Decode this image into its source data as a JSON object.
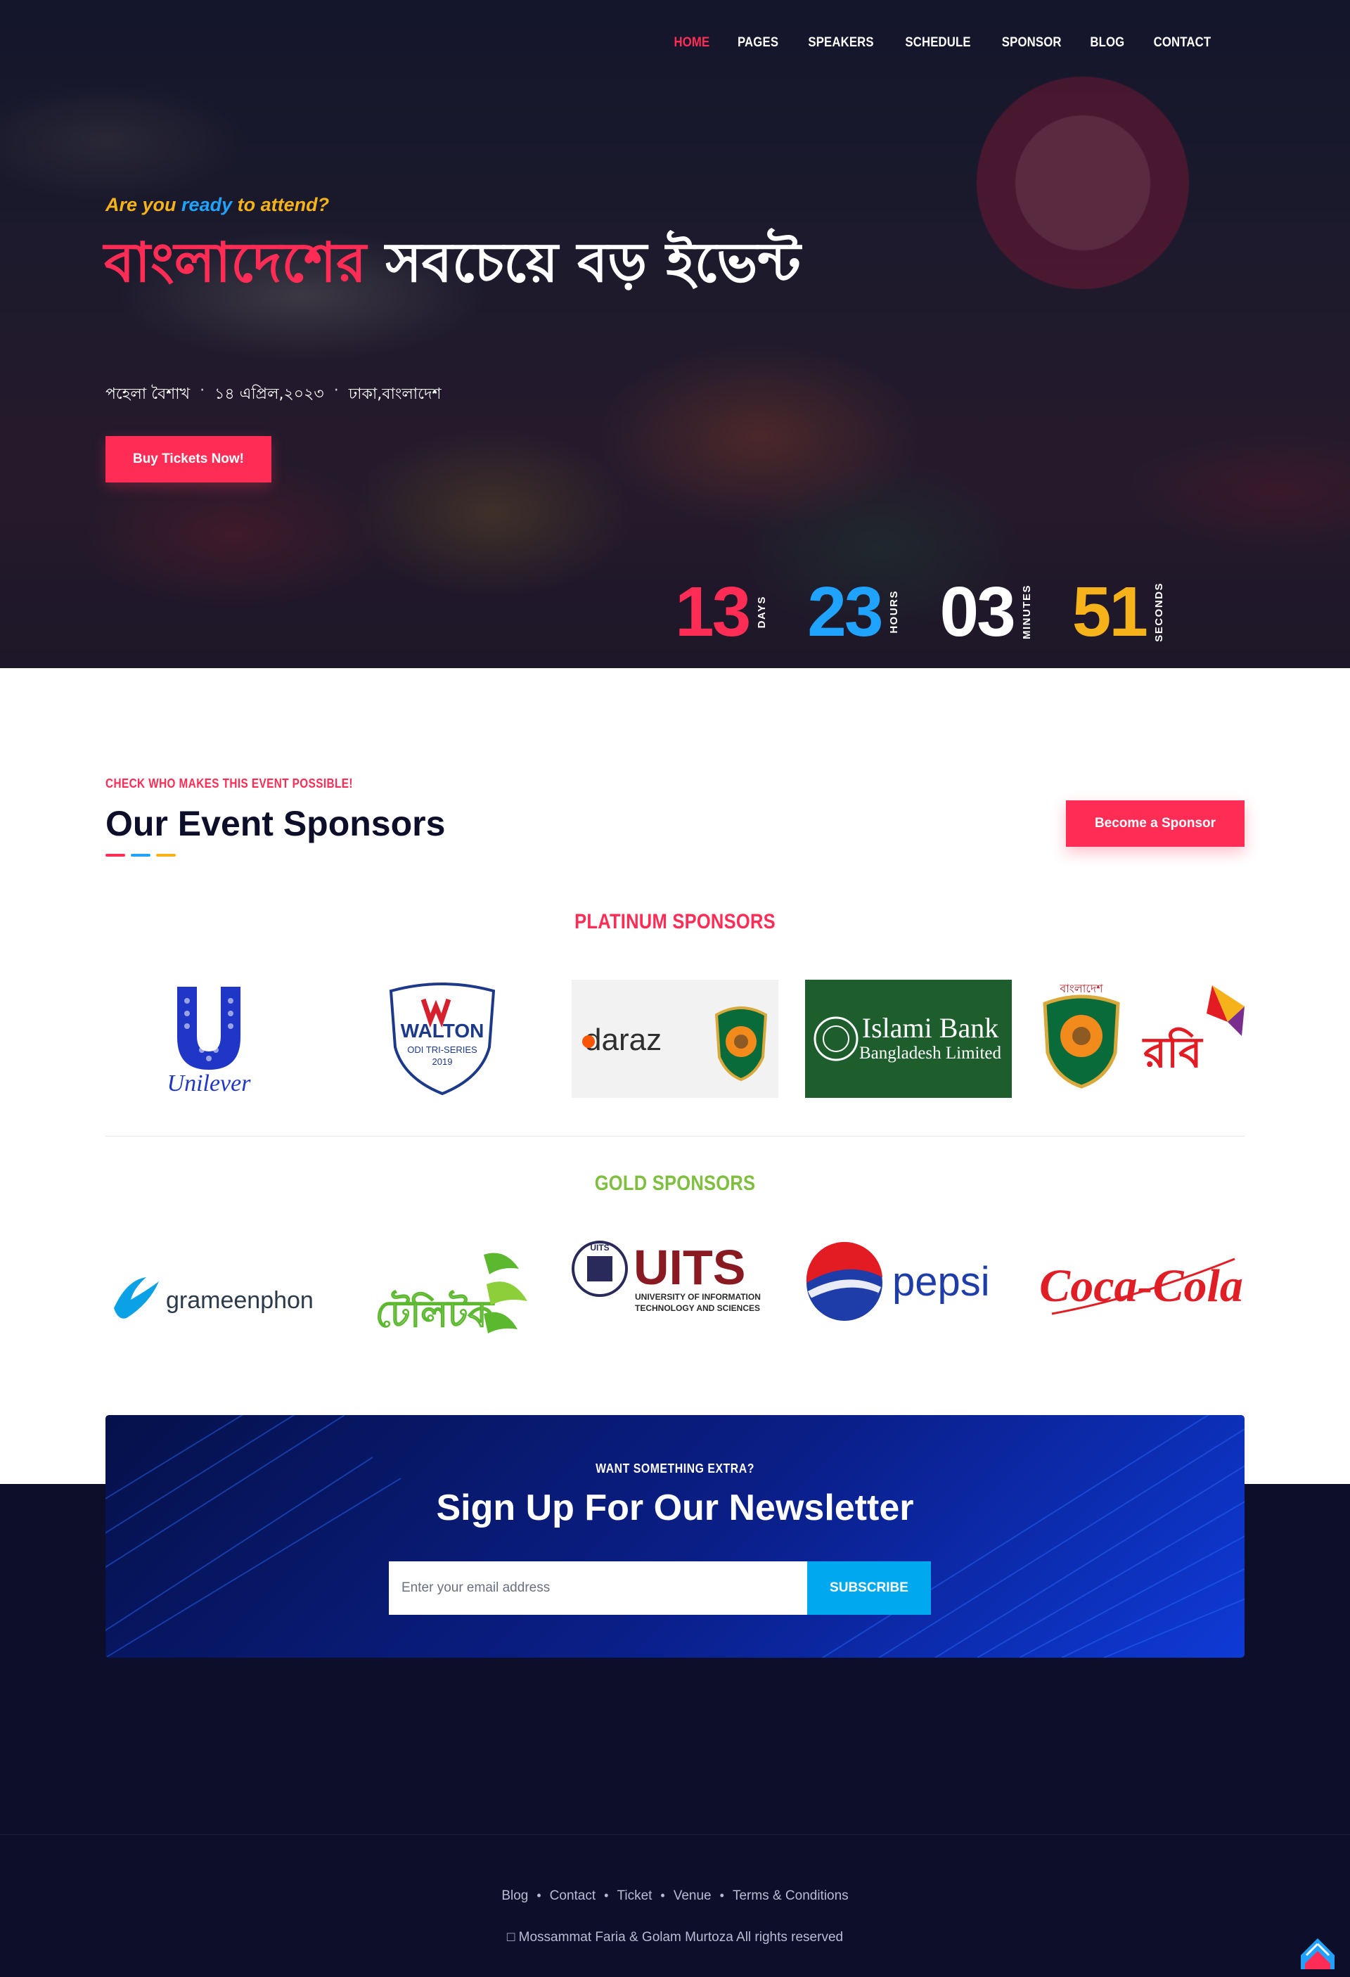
{
  "nav": {
    "items": [
      {
        "label": "HOME",
        "active": true
      },
      {
        "label": "PAGES"
      },
      {
        "label": "SPEAKERS"
      },
      {
        "label": "SCHEDULE"
      },
      {
        "label": "SPONSOR"
      },
      {
        "label": "BLOG"
      },
      {
        "label": "CONTACT"
      }
    ]
  },
  "hero": {
    "tagline_prefix": "Are you",
    "tagline_highlight": "ready",
    "tagline_suffix": "to attend?",
    "headline_highlight": "বাংলাদেশের",
    "headline_rest": " সবচেয়ে বড় ইভেন্ট",
    "meta": [
      "পহেলা বৈশাখ",
      "১৪ এপ্রিল,২০২৩",
      "ঢাকা,বাংলাদেশ"
    ],
    "buy_button": "Buy Tickets Now!"
  },
  "countdown": [
    {
      "value": "13",
      "label": "DAYS"
    },
    {
      "value": "23",
      "label": "HOURS"
    },
    {
      "value": "03",
      "label": "MINUTES"
    },
    {
      "value": "51",
      "label": "SECONDS"
    }
  ],
  "sponsors": {
    "kicker": "CHECK WHO MAKES THIS EVENT POSSIBLE!",
    "title": "Our Event Sponsors",
    "become_button": "Become a Sponsor",
    "platinum_title": "PLATINUM SPONSORS",
    "gold_title": "GOLD SPONSORS",
    "logos": {
      "unilever": "Unilever",
      "walton": "WALTON",
      "walton_sub": "ODI TRI-SERIES",
      "walton_year": "2019",
      "daraz": "daraz",
      "islami_bank_1": "Islami Bank",
      "islami_bank_2": "Bangladesh Limited",
      "bcb_top": "বাংলাদেশ",
      "robi": "রবি",
      "grameenphone": "grameenphone",
      "teletalk": "টেলিটক",
      "uits": "UITS",
      "uits_sub1": "UNIVERSITY OF INFORMATION",
      "uits_sub2": "TECHNOLOGY AND SCIENCES",
      "pepsi": "pepsi",
      "cocacola": "Coca-Cola"
    }
  },
  "newsletter": {
    "kicker": "WANT SOMETHING EXTRA?",
    "title": "Sign Up For Our Newsletter",
    "placeholder": "Enter your email address",
    "button": "SUBSCRIBE"
  },
  "footer": {
    "links": [
      "Blog",
      "Contact",
      "Ticket",
      "Venue",
      "Terms & Conditions"
    ],
    "copyright": "□ Mossammat Faria & Golam Murtoza All rights reserved"
  },
  "colors": {
    "accent_red": "#ff2d55",
    "accent_blue": "#1fa3ff",
    "accent_yellow": "#f6b21a",
    "gold_green": "#7fbf3f",
    "dark_navy": "#0d0e2a"
  }
}
